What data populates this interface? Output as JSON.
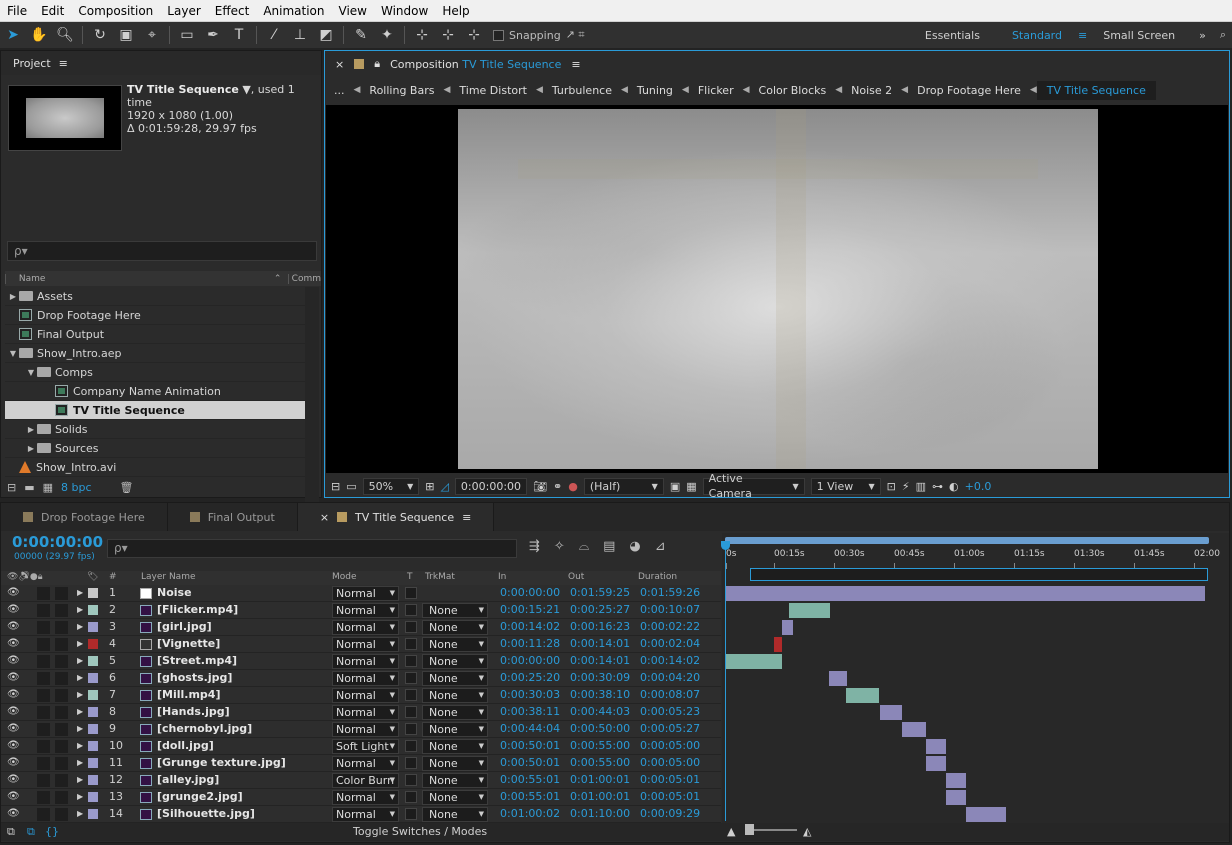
{
  "menu": [
    "File",
    "Edit",
    "Composition",
    "Layer",
    "Effect",
    "Animation",
    "View",
    "Window",
    "Help"
  ],
  "toolbar": {
    "snapping_label": "Snapping",
    "workspaces": [
      "Essentials",
      "Standard",
      "Small Screen"
    ],
    "active_workspace": "Standard",
    "more": "»"
  },
  "project": {
    "title": "Project",
    "selected_name": "TV Title Sequence",
    "selected_used": ", used 1 time",
    "selected_dims": "1920 x 1080 (1.00)",
    "selected_duration": "Δ 0:01:59:28, 29.97 fps",
    "search_placeholder": "ρ▾",
    "col_name": "Name",
    "col_comment": "Comm",
    "items": [
      {
        "label": "Assets",
        "kind": "folder",
        "depth": 0,
        "tri": "▶"
      },
      {
        "label": "Drop Footage Here",
        "kind": "comp",
        "depth": 0,
        "tri": ""
      },
      {
        "label": "Final Output",
        "kind": "comp",
        "depth": 0,
        "tri": ""
      },
      {
        "label": "Show_Intro.aep",
        "kind": "folder",
        "depth": 0,
        "tri": "▼"
      },
      {
        "label": "Comps",
        "kind": "folder",
        "depth": 1,
        "tri": "▼"
      },
      {
        "label": "Company Name Animation",
        "kind": "comp",
        "depth": 2,
        "tri": ""
      },
      {
        "label": "TV Title Sequence",
        "kind": "comp",
        "depth": 2,
        "tri": "",
        "selected": true
      },
      {
        "label": "Solids",
        "kind": "folder",
        "depth": 1,
        "tri": "▶"
      },
      {
        "label": "Sources",
        "kind": "folder",
        "depth": 1,
        "tri": "▶"
      },
      {
        "label": "Show_Intro.avi",
        "kind": "avi",
        "depth": 0,
        "tri": ""
      }
    ],
    "bpc": "8 bpc"
  },
  "composition": {
    "tab_label": "Composition",
    "tab_comp": "TV Title Sequence",
    "ellipsis": "...",
    "breadcrumbs": [
      "Rolling Bars",
      "Time Distort",
      "Turbulence",
      "Tuning",
      "Flicker",
      "Color Blocks",
      "Noise 2",
      "Drop Footage Here",
      "TV Title Sequence"
    ],
    "zoom": "50%",
    "timecode": "0:00:00:00",
    "resolution": "(Half)",
    "camera": "Active Camera",
    "views": "1 View",
    "exposure": "+0.0"
  },
  "timeline": {
    "tabs": [
      "Drop Footage Here",
      "Final Output",
      "TV Title Sequence"
    ],
    "active_tab": "TV Title Sequence",
    "timecode": "0:00:00:00",
    "fps": "00000 (29.97 fps)",
    "search_placeholder": "ρ▾",
    "headers": {
      "num": "#",
      "layer_name": "Layer Name",
      "mode": "Mode",
      "t": "T",
      "trkmat": "TrkMat",
      "in": "In",
      "out": "Out",
      "duration": "Duration"
    },
    "ruler": [
      "0s",
      "00:15s",
      "00:30s",
      "00:45s",
      "01:00s",
      "01:15s",
      "01:30s",
      "01:45s",
      "02:00"
    ],
    "toggle_label": "Toggle Switches / Modes",
    "layers": [
      {
        "num": "1",
        "name": "Noise",
        "mode": "Normal",
        "trkmat": "",
        "in": "0:00:00:00",
        "out": "0:01:59:25",
        "dur": "0:01:59:26",
        "color": "#c8c8c8"
      },
      {
        "num": "2",
        "name": "[Flicker.mp4]",
        "mode": "Normal",
        "trkmat": "None",
        "in": "0:00:15:21",
        "out": "0:00:25:27",
        "dur": "0:00:10:07",
        "color": "#9fc7bd"
      },
      {
        "num": "3",
        "name": "[girl.jpg]",
        "mode": "Normal",
        "trkmat": "None",
        "in": "0:00:14:02",
        "out": "0:00:16:23",
        "dur": "0:00:02:22",
        "color": "#9a9acb"
      },
      {
        "num": "4",
        "name": "[Vignette]",
        "mode": "Normal",
        "trkmat": "None",
        "in": "0:00:11:28",
        "out": "0:00:14:01",
        "dur": "0:00:02:04",
        "color": "#b02a2a"
      },
      {
        "num": "5",
        "name": "[Street.mp4]",
        "mode": "Normal",
        "trkmat": "None",
        "in": "0:00:00:00",
        "out": "0:00:14:01",
        "dur": "0:00:14:02",
        "color": "#9fc7bd"
      },
      {
        "num": "6",
        "name": "[ghosts.jpg]",
        "mode": "Normal",
        "trkmat": "None",
        "in": "0:00:25:20",
        "out": "0:00:30:09",
        "dur": "0:00:04:20",
        "color": "#9a9acb"
      },
      {
        "num": "7",
        "name": "[Mill.mp4]",
        "mode": "Normal",
        "trkmat": "None",
        "in": "0:00:30:03",
        "out": "0:00:38:10",
        "dur": "0:00:08:07",
        "color": "#9fc7bd"
      },
      {
        "num": "8",
        "name": "[Hands.jpg]",
        "mode": "Normal",
        "trkmat": "None",
        "in": "0:00:38:11",
        "out": "0:00:44:03",
        "dur": "0:00:05:23",
        "color": "#9a9acb"
      },
      {
        "num": "9",
        "name": "[chernobyl.jpg]",
        "mode": "Normal",
        "trkmat": "None",
        "in": "0:00:44:04",
        "out": "0:00:50:00",
        "dur": "0:00:05:27",
        "color": "#9a9acb"
      },
      {
        "num": "10",
        "name": "[doll.jpg]",
        "mode": "Soft Light",
        "trkmat": "None",
        "in": "0:00:50:01",
        "out": "0:00:55:00",
        "dur": "0:00:05:00",
        "color": "#9a9acb"
      },
      {
        "num": "11",
        "name": "[Grunge texture.jpg]",
        "mode": "Normal",
        "trkmat": "None",
        "in": "0:00:50:01",
        "out": "0:00:55:00",
        "dur": "0:00:05:00",
        "color": "#9a9acb"
      },
      {
        "num": "12",
        "name": "[alley.jpg]",
        "mode": "Color Burn",
        "trkmat": "None",
        "in": "0:00:55:01",
        "out": "0:01:00:01",
        "dur": "0:00:05:01",
        "color": "#9a9acb"
      },
      {
        "num": "13",
        "name": "[grunge2.jpg]",
        "mode": "Normal",
        "trkmat": "None",
        "in": "0:00:55:01",
        "out": "0:01:00:01",
        "dur": "0:00:05:01",
        "color": "#9a9acb"
      },
      {
        "num": "14",
        "name": "[Silhouette.jpg]",
        "mode": "Normal",
        "trkmat": "None",
        "in": "0:01:00:02",
        "out": "0:01:10:00",
        "dur": "0:00:09:29",
        "color": "#9a9acb"
      }
    ],
    "bars": [
      {
        "start": 0,
        "end": 119.8,
        "color": "#8b87b8"
      },
      {
        "start": 15.7,
        "end": 25.9,
        "color": "#7fb3a5"
      },
      {
        "start": 14.1,
        "end": 16.8,
        "color": "#8b87b8"
      },
      {
        "start": 12.0,
        "end": 14.0,
        "color": "#b02a2a"
      },
      {
        "start": 0,
        "end": 14.0,
        "color": "#7fb3a5"
      },
      {
        "start": 25.7,
        "end": 30.3,
        "color": "#8b87b8"
      },
      {
        "start": 30.1,
        "end": 38.3,
        "color": "#7fb3a5"
      },
      {
        "start": 38.4,
        "end": 44.1,
        "color": "#8b87b8"
      },
      {
        "start": 44.1,
        "end": 50.0,
        "color": "#8b87b8"
      },
      {
        "start": 50.0,
        "end": 55.0,
        "color": "#8b87b8"
      },
      {
        "start": 50.0,
        "end": 55.0,
        "color": "#8b87b8"
      },
      {
        "start": 55.0,
        "end": 60.0,
        "color": "#8b87b8"
      },
      {
        "start": 55.0,
        "end": 60.0,
        "color": "#8b87b8"
      },
      {
        "start": 60.1,
        "end": 70.0,
        "color": "#8b87b8"
      }
    ]
  }
}
